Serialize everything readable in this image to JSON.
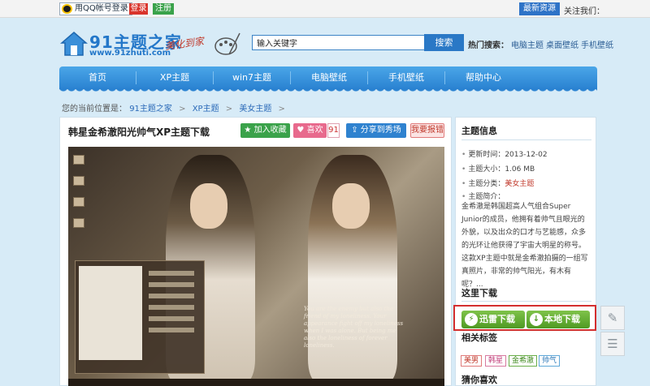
{
  "topbar": {
    "qq_login": "用QQ帐号登录",
    "login": "登录",
    "register": "注册",
    "latest": "最新资源",
    "follow": "关注我们："
  },
  "header": {
    "logo_text": "91主题之家",
    "logo_url": "www.91zhuti.com",
    "slogan": "美化到家",
    "search_value": "输入关键字",
    "search_button": "搜索",
    "hot_label": "热门搜索：",
    "hot_links": [
      "电脑主题",
      "桌面壁纸",
      "手机壁纸"
    ]
  },
  "nav": {
    "items": [
      "首页",
      "XP主题",
      "win7主题",
      "电脑壁纸",
      "手机壁纸",
      "帮助中心"
    ]
  },
  "breadcrumb": {
    "prefix": "您的当前位置是：",
    "items": [
      "91主题之家",
      "XP主题",
      "美女主题"
    ],
    "sep": ">"
  },
  "main": {
    "title": "韩星金希澈阳光帅气XP主题下载",
    "fav": "加入收藏",
    "like": "喜欢",
    "like_count": "91",
    "share": "分享到秀场",
    "report": "我要报错",
    "quote": "You are the enemy but also the friend of my loneliness. Your appearance fight off my loneliness when I was alone. But being me also the loneliness of forever loneliness."
  },
  "side": {
    "info_title": "主题信息",
    "rows": [
      {
        "label": "更新时间：",
        "value": "2013-12-02"
      },
      {
        "label": "主题大小：",
        "value": "1.06 MB"
      },
      {
        "label": "主题分类：",
        "value": "美女主题"
      },
      {
        "label": "主题简介：",
        "value": ""
      }
    ],
    "intro": "金希澈是韩国超高人气组合Super Junior的成员，他拥有着帅气且眼光的外貌，以及出众的口才与艺能感，众多的光环让他获得了宇宙大明星的称号。这款XP主题中就是金希澈拍摄的一组写真照片，非常的帅气阳光，有木有呢？...",
    "download_title": "这里下载",
    "dl_thunder": "迅雷下载",
    "dl_local": "本地下载",
    "tags_title": "相关标签",
    "tags": [
      "美男",
      "韩星",
      "金希澈",
      "帅气"
    ],
    "guess_title": "猜你喜欢"
  },
  "colors": {
    "accent_blue": "#2a78c6",
    "download_green": "#4f9a23",
    "highlight_red": "#d32f2f"
  }
}
